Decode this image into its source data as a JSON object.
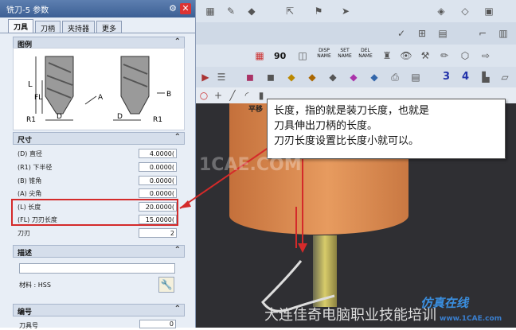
{
  "panel": {
    "title": "铣刀-5 参数",
    "tabs": [
      "刀具",
      "刀柄",
      "夹持器",
      "更多"
    ],
    "sections": {
      "legend": "图例",
      "dimensions": "尺寸",
      "description": "描述",
      "numbering": "编号"
    },
    "diagram_labels": {
      "L": "L",
      "FL": "FL",
      "D": "D",
      "R1": "R1",
      "A": "A",
      "B": "B",
      "D2": "D",
      "R1b": "R1"
    },
    "params": [
      {
        "label": "(D) 直径",
        "value": "4.0000("
      },
      {
        "label": "(R1) 下半径",
        "value": "0.0000("
      },
      {
        "label": "(B) 锥角",
        "value": "0.0000("
      },
      {
        "label": "(A) 尖角",
        "value": "0.0000("
      },
      {
        "label": "(L) 长度",
        "value": "20.0000("
      },
      {
        "label": "(FL) 刀刃长度",
        "value": "15.0000("
      },
      {
        "label": "刀刃",
        "value": "2"
      }
    ],
    "material_label": "材料 : HSS",
    "tool_number_label": "刀具号",
    "tool_number_value": "0"
  },
  "toolbar": {
    "buttons": [
      "DISP NAME",
      "SET NAME",
      "DEL NAME"
    ],
    "numbers": [
      "90",
      "3",
      "4"
    ],
    "view_label": "平移"
  },
  "callout": {
    "lines": [
      "长度，指的就是装刀长度，也就是",
      "刀具伸出刀柄的长度。",
      "刀刃长度设置比长度小就可以。"
    ]
  },
  "watermarks": {
    "center": "1CAE.COM",
    "footer": "大连佳奇电脑职业技能培训",
    "site": "www.1CAE.com",
    "corner": "仿真在线"
  },
  "colors": {
    "highlight": "#d42a2a",
    "titlebar": "#3c5f94",
    "cylinder": "#e79b5f"
  }
}
